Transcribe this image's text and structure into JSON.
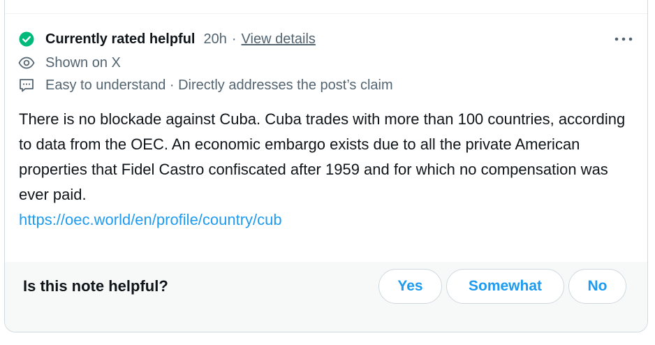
{
  "status": {
    "label": "Currently rated helpful",
    "time": "20h",
    "separator": "·",
    "view_details": "View details",
    "icon": "check-circle-icon",
    "icon_color": "#00ba7c"
  },
  "shown": {
    "text": "Shown on X",
    "icon": "eye-icon"
  },
  "tags": {
    "text": "Easy to understand · Directly addresses the post’s claim",
    "icon": "message-icon"
  },
  "more": {
    "icon": "more-icon",
    "glyph": "•••"
  },
  "note": {
    "text": "There is no blockade against Cuba. Cuba trades with more than 100 countries, according to data from the OEC. An economic embargo exists due to all the private American properties that Fidel Castro confiscated after 1959 and for which no compensation was ever paid.",
    "link": "https://oec.world/en/profile/country/cub"
  },
  "rating": {
    "question": "Is this note helpful?",
    "yes": "Yes",
    "somewhat": "Somewhat",
    "no": "No"
  },
  "colors": {
    "link": "#1d9bf0",
    "muted": "#536471",
    "text": "#0f1419"
  }
}
